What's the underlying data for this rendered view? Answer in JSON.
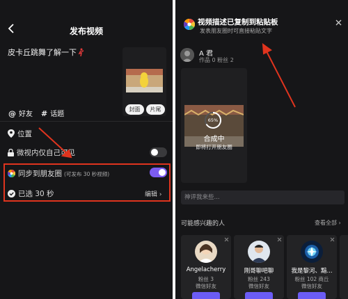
{
  "left": {
    "header": {
      "title": "发布视频"
    },
    "caption": "皮卡丘跳舞了解一下",
    "thumb_buttons": {
      "cover": "封面",
      "clip": "片尾"
    },
    "tags": {
      "friend_symbol": "@",
      "friend": "好友",
      "topic_symbol": "#",
      "topic": "话题"
    },
    "location": "位置",
    "visible_self": "微视内仅自己可见",
    "moments": {
      "label": "同步到朋友圈",
      "note": "(可发布 30 秒视频)",
      "enabled": true
    },
    "selected": "已选 30 秒",
    "edit": "编辑 ›"
  },
  "right": {
    "toast": {
      "title": "视频描述已复制到粘贴板",
      "subtitle": "发表朋友圈时可直接粘贴文字"
    },
    "user": {
      "name": "A 君",
      "stats": "作品 0   粉丝 2"
    },
    "video": {
      "progress": "65%",
      "status": "合成中",
      "sub": "即将打开朋友圈"
    },
    "comment_placeholder": "神评我来些...",
    "recommend": {
      "title": "可能感兴趣的人",
      "see_all": "查看全部 ›",
      "cards": [
        {
          "name": "Angelacherry",
          "fans": "粉丝 3",
          "mutual": "微信好友"
        },
        {
          "name": "刚哥聊吧聊",
          "fans": "粉丝 243",
          "mutual": "微信好友"
        },
        {
          "name": "我是黎河、黯...",
          "fans": "粉丝 102  商丘",
          "mutual": "微信好友"
        },
        {
          "name": "",
          "fans": "",
          "mutual": ""
        }
      ]
    }
  },
  "colors": {
    "accent": "#7c5cf2",
    "highlight_box": "#e0341e",
    "arrow": "#e0341e",
    "background": "#161618"
  }
}
